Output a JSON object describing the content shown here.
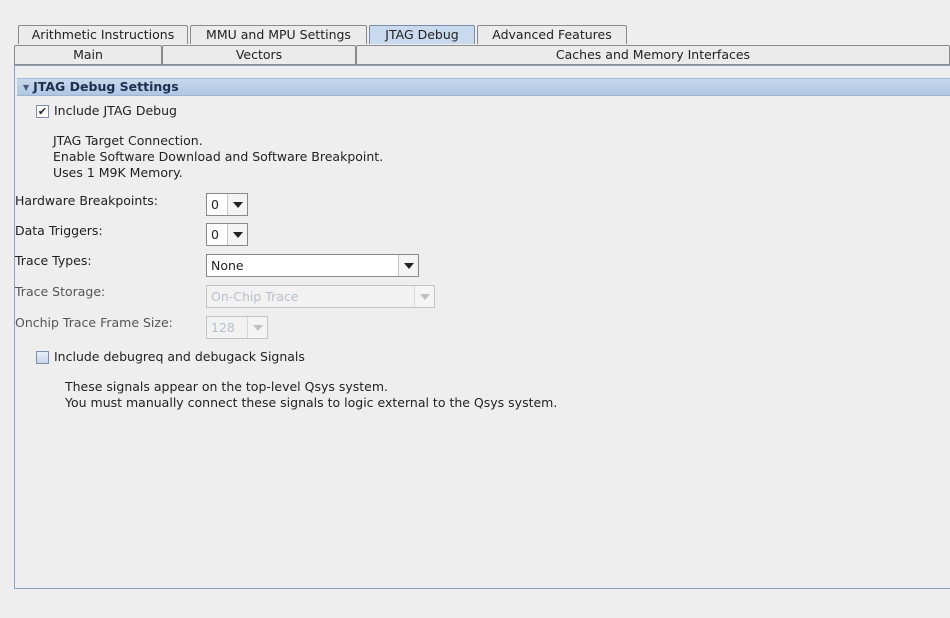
{
  "tabs_top": [
    "Arithmetic Instructions",
    "MMU and MPU Settings",
    "JTAG Debug",
    "Advanced Features"
  ],
  "tabs_bottom": [
    "Main",
    "Vectors",
    "Caches and Memory Interfaces"
  ],
  "selected_tab": "JTAG Debug",
  "section": {
    "title": "JTAG Debug Settings"
  },
  "include_jtag": {
    "label": "Include JTAG Debug",
    "checked": true,
    "mark": "✔"
  },
  "jtag_info": [
    "JTAG Target Connection.",
    "Enable Software Download and Software Breakpoint.",
    "Uses 1 M9K Memory."
  ],
  "hw_breakpoints": {
    "label": "Hardware Breakpoints:",
    "value": "0"
  },
  "data_triggers": {
    "label": "Data Triggers:",
    "value": "0"
  },
  "trace_types": {
    "label": "Trace Types:",
    "value": "None"
  },
  "trace_storage": {
    "label": "Trace Storage:",
    "value": "On-Chip Trace",
    "enabled": false
  },
  "trace_frame_size": {
    "label": "Onchip Trace Frame Size:",
    "value": "128",
    "enabled": false
  },
  "debugreq": {
    "label": "Include debugreq and debugack Signals",
    "checked": false
  },
  "debugreq_info": [
    "These signals appear on the top-level Qsys system.",
    "You must manually connect these signals to logic external to the Qsys system."
  ],
  "colors": {
    "section_bar": "#b8cce6",
    "selected_tab": "#c9d9ee",
    "panel_border": "#8aa2c6"
  }
}
